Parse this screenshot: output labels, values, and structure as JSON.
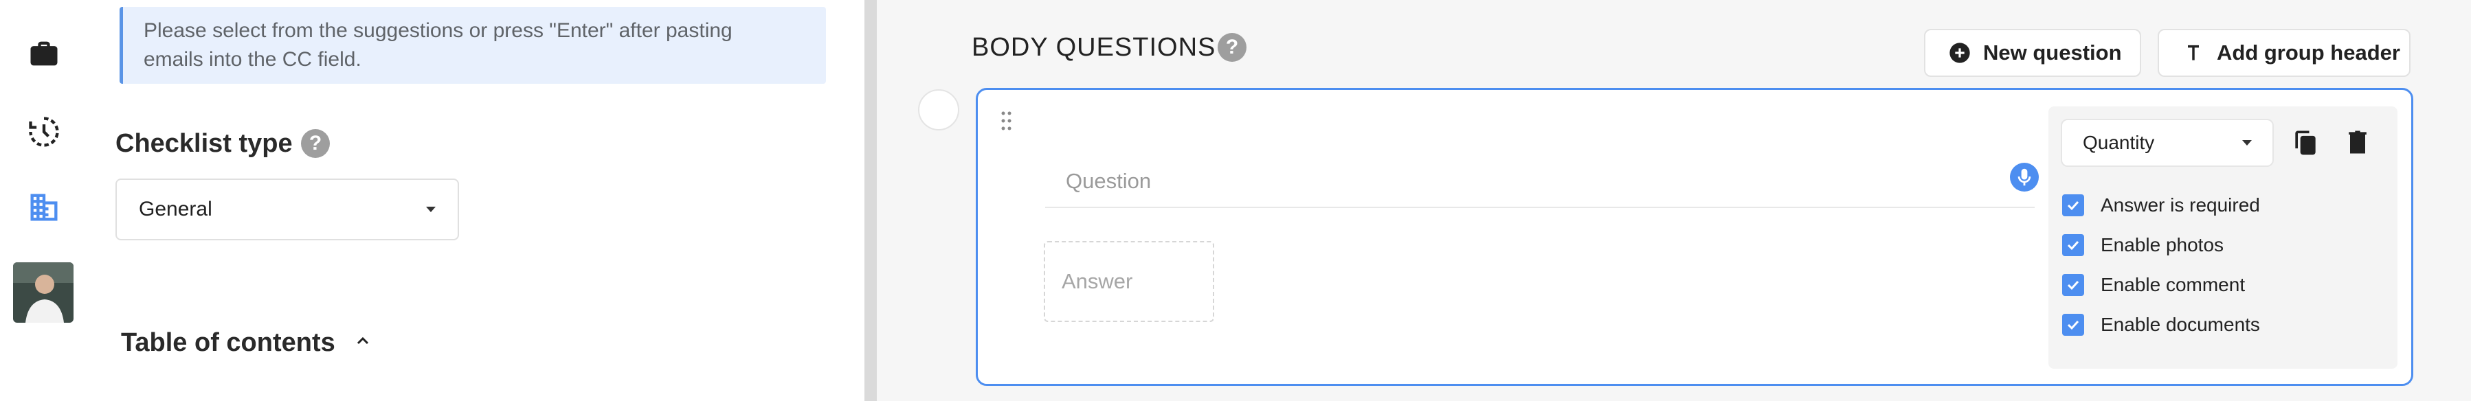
{
  "info": {
    "line1": "Please select from the suggestions or press \"Enter\" after pasting",
    "line2": "emails into the CC field."
  },
  "checklist": {
    "title": "Checklist type",
    "help": "?",
    "type_value": "General"
  },
  "toc": {
    "title": "Table of contents"
  },
  "body": {
    "title": "BODY QUESTIONS",
    "help": "?",
    "new_question_label": "New question",
    "add_group_header_label": "Add group header"
  },
  "question_card": {
    "question_placeholder": "Question",
    "answer_placeholder": "Answer",
    "answer_type": "Quantity",
    "options": [
      {
        "label": "Answer is required",
        "checked": true
      },
      {
        "label": "Enable photos",
        "checked": true
      },
      {
        "label": "Enable comment",
        "checked": true
      },
      {
        "label": "Enable documents",
        "checked": true
      }
    ]
  },
  "colors": {
    "accent": "#4d8ef0",
    "info_bg": "#e8f0fd"
  },
  "icons": [
    "briefcase-icon",
    "history-icon",
    "building-icon",
    "plus-circle-icon",
    "text-t-icon",
    "drag-handle-icon",
    "mic-icon",
    "copy-icon",
    "trash-icon"
  ]
}
